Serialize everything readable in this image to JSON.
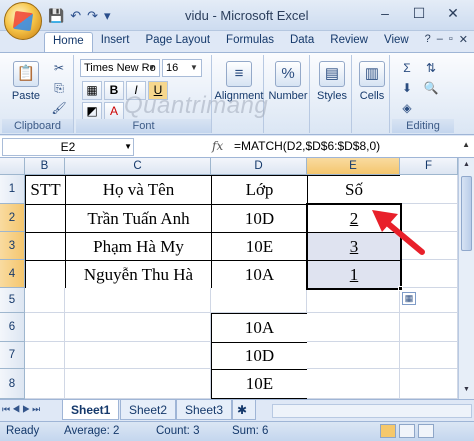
{
  "window": {
    "title": "vidu - Microsoft Excel"
  },
  "qat": {
    "save": "save-icon",
    "undo": "undo-icon",
    "redo": "redo-icon",
    "customize": "customize-icon"
  },
  "window_controls": {
    "minimize": "–",
    "maximize": "☐",
    "close": "✕"
  },
  "ribbon_tabs": [
    "Home",
    "Insert",
    "Page Layout",
    "Formulas",
    "Data",
    "Review",
    "View"
  ],
  "mdi_controls": {
    "help": "?",
    "minimize": "–",
    "restore": "▫",
    "close": "✕"
  },
  "ribbon": {
    "paste_label": "Paste",
    "clipboard_group": "Clipboard",
    "font_name": "Times New Ro",
    "font_size": "16",
    "bold": "B",
    "italic": "I",
    "underline": "U",
    "font_group": "Font",
    "alignment_label": "Alignment",
    "number_label": "Number",
    "styles_label": "Styles",
    "cells_label": "Cells",
    "editing_group": "Editing",
    "watermark": "Quantrimang"
  },
  "formula_bar": {
    "name_box": "E2",
    "fx": "fx",
    "formula": "=MATCH(D2,$D$6:$D$8,0)"
  },
  "columns": [
    "B",
    "C",
    "D",
    "E",
    "F"
  ],
  "rows": [
    "1",
    "2",
    "3",
    "4",
    "5",
    "6",
    "7",
    "8"
  ],
  "cells": {
    "B1": "STT",
    "C1": "Họ và Tên",
    "D1": "Lớp",
    "E1": "Số",
    "C2": "Trần Tuấn Anh",
    "D2": "10D",
    "E2": "2",
    "C3": "Phạm Hà My",
    "D3": "10E",
    "E3": "3",
    "C4": "Nguyễn Thu Hà",
    "D4": "10A",
    "E4": "1",
    "D6": "10A",
    "D7": "10D",
    "D8": "10E"
  },
  "sheet_tabs": [
    "Sheet1",
    "Sheet2",
    "Sheet3"
  ],
  "status": {
    "ready": "Ready",
    "average": "Average: 2",
    "count": "Count: 3",
    "sum": "Sum: 6"
  },
  "colors": {
    "annotation_arrow": "#e8202a",
    "selection_header": "#f4c66e"
  }
}
